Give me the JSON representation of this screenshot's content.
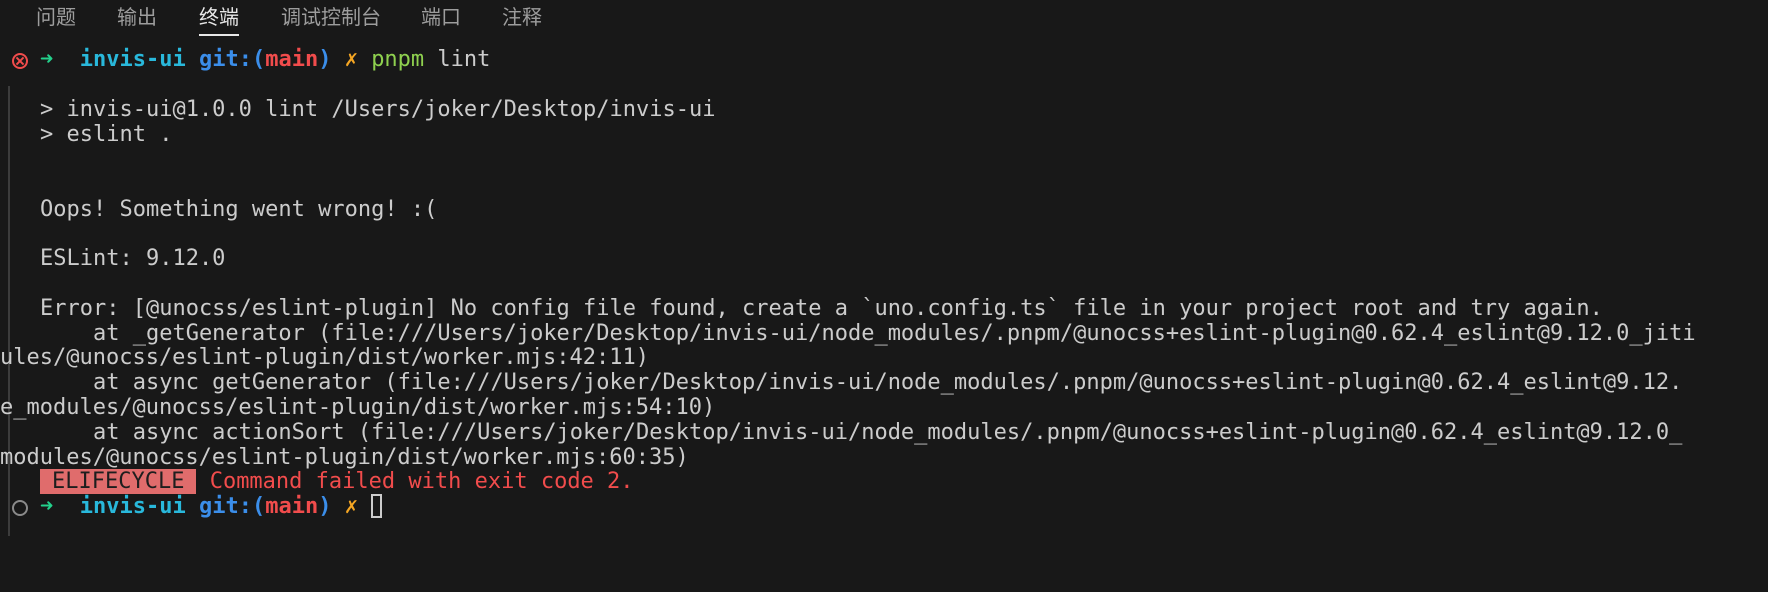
{
  "panel": {
    "tabs": [
      {
        "label": "问题"
      },
      {
        "label": "输出"
      },
      {
        "label": "终端"
      },
      {
        "label": "调试控制台"
      },
      {
        "label": "端口"
      },
      {
        "label": "注释"
      }
    ],
    "active_tab": "终端"
  },
  "prompt": {
    "arrow": "➜",
    "dir": "invis-ui",
    "git_label": "git:(",
    "branch": "main",
    "git_close": ")",
    "dirty": "✗"
  },
  "command": {
    "bin": "pnpm",
    "args": " lint"
  },
  "output": {
    "script_line1": "> invis-ui@1.0.0 lint /Users/joker/Desktop/invis-ui",
    "script_line2": "> eslint .",
    "oops": "Oops! Something went wrong! :(",
    "version": "ESLint: 9.12.0",
    "error": "Error: [@unocss/eslint-plugin] No config file found, create a `uno.config.ts` file in your project root and try again.",
    "stack": [
      {
        "line": "    at _getGenerator (file:///Users/joker/Desktop/invis-ui/node_modules/.pnpm/@unocss+eslint-plugin@0.62.4_eslint@9.12.0_jiti",
        "cont": "ules/@unocss/eslint-plugin/dist/worker.mjs:42:11)"
      },
      {
        "line": "    at async getGenerator (file:///Users/joker/Desktop/invis-ui/node_modules/.pnpm/@unocss+eslint-plugin@0.62.4_eslint@9.12.",
        "cont": "e_modules/@unocss/eslint-plugin/dist/worker.mjs:54:10)"
      },
      {
        "line": "    at async actionSort (file:///Users/joker/Desktop/invis-ui/node_modules/.pnpm/@unocss+eslint-plugin@0.62.4_eslint@9.12.0_",
        "cont": "modules/@unocss/eslint-plugin/dist/worker.mjs:60:35)"
      }
    ],
    "lifecycle_badge": "ELIFECYCLE",
    "lifecycle_message": " Command failed with exit code 2."
  },
  "colors": {
    "background": "#181818",
    "prompt_arrow": "#23d18b",
    "dir": "#29b8db",
    "git": "#3b8eea",
    "branch": "#f14c4c",
    "dirty": "#f5a623",
    "command": "#8fd14f",
    "error_badge": "#e06c6c",
    "error_text": "#f14c4c"
  },
  "icons": {
    "failed_decoration": "error-circle-icon",
    "pending_decoration": "empty-circle-icon",
    "cursor": "block-cursor-icon"
  }
}
